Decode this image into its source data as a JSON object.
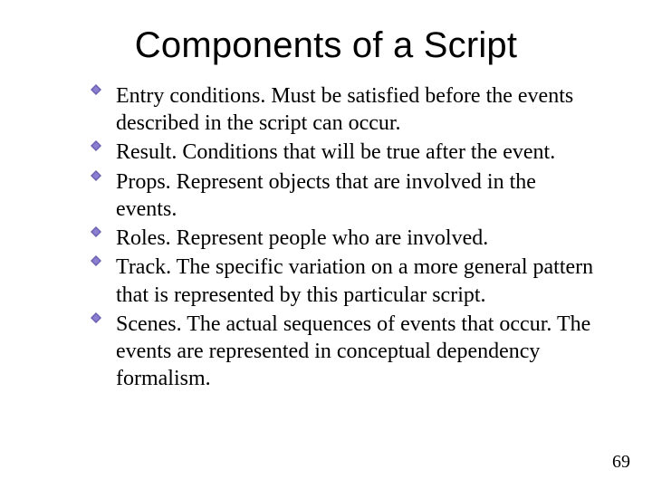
{
  "title": "Components of a Script",
  "bullets": [
    "Entry conditions. Must be satisfied before the events described in the script can occur.",
    "Result. Conditions that will be true after the event.",
    "Props. Represent objects that are involved in the events.",
    "Roles. Represent people who are involved.",
    "Track. The specific variation on a more general pattern that is represented by this particular script.",
    "Scenes. The actual sequences of events that occur. The events are represented in conceptual dependency formalism."
  ],
  "page_number": "69",
  "colors": {
    "bullet": "#5a4fa0"
  }
}
